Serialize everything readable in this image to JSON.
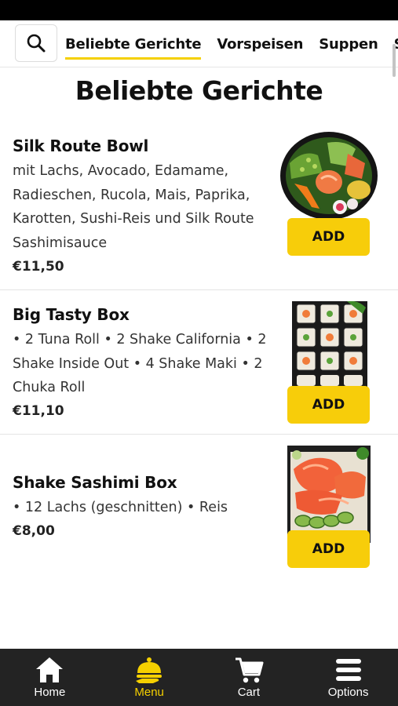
{
  "categories": [
    {
      "label": "Beliebte Gerichte",
      "active": true
    },
    {
      "label": "Vorspeisen",
      "active": false
    },
    {
      "label": "Suppen",
      "active": false
    },
    {
      "label": "S",
      "active": false
    }
  ],
  "page_title": "Beliebte Gerichte",
  "items": [
    {
      "name": "Silk Route Bowl",
      "description": "mit Lachs, Avocado, Edamame, Radieschen, Rucola, Mais, Paprika, Karotten, Sushi-Reis und Silk Route Sashimisauce",
      "price": "€11,50",
      "add_label": "ADD"
    },
    {
      "name": "Big Tasty Box",
      "description": "• 2 Tuna Roll • 2 Shake California • 2 Shake Inside Out • 4 Shake Maki • 2 Chuka Roll",
      "price": "€11,10",
      "add_label": "ADD"
    },
    {
      "name": "Shake Sashimi Box",
      "description": "• 12 Lachs (geschnitten) • Reis",
      "price": "€8,00",
      "add_label": "ADD"
    }
  ],
  "bottom_nav": [
    {
      "label": "Home",
      "icon": "home-icon",
      "active": false
    },
    {
      "label": "Menu",
      "icon": "cloche-icon",
      "active": true
    },
    {
      "label": "Cart",
      "icon": "cart-icon",
      "active": false
    },
    {
      "label": "Options",
      "icon": "menu-icon",
      "active": false
    }
  ],
  "colors": {
    "accent": "#f7cd0a",
    "nav_background": "#232323",
    "active_nav": "#f5d000"
  }
}
